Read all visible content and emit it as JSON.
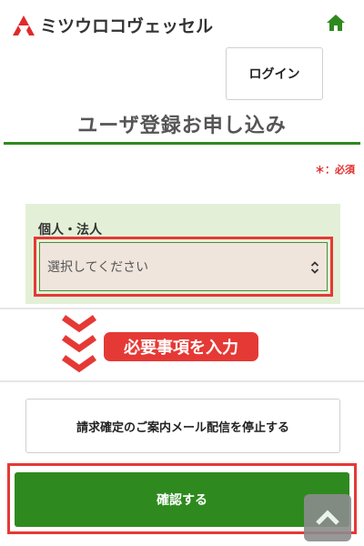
{
  "header": {
    "brand": "ミツウロコヴェッセル",
    "logo_icon": "mitsuuroko-triangle-logo",
    "home_icon": "home-icon"
  },
  "login": {
    "label": "ログイン"
  },
  "page": {
    "title": "ユーザ登録お申し込み",
    "required_note": "＊：必須"
  },
  "form": {
    "field_label": "個人・法人",
    "select_value": "選択してください",
    "select_icon": "chevron-updown-icon"
  },
  "guide": {
    "badge": "必要事項を入力",
    "arrows_icon": "triple-chevron-down-icon"
  },
  "actions": {
    "stop_notification_label": "請求確定のご案内メール配信を停止する",
    "confirm_label": "確認する",
    "scroll_top_icon": "chevron-up-icon"
  },
  "colors": {
    "accent_green": "#2e8a1e",
    "highlight_red": "#e53935",
    "panel_green": "#e3f0d7"
  }
}
